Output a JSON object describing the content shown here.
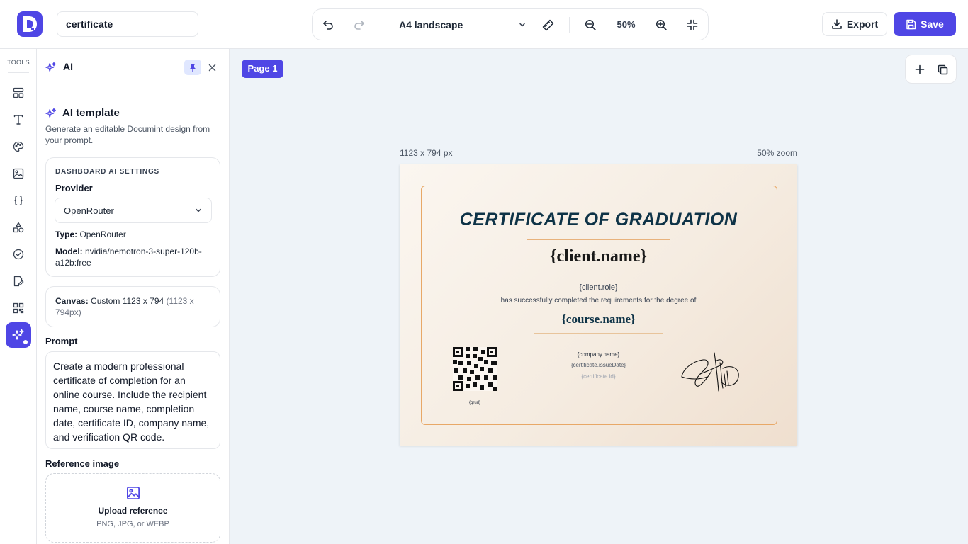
{
  "header": {
    "doc_name": "certificate",
    "page_size": "A4 landscape",
    "zoom": "50%",
    "export_label": "Export",
    "save_label": "Save"
  },
  "rail": {
    "title": "TOOLS",
    "items": [
      "layout-icon",
      "text-icon",
      "palette-icon",
      "image-icon",
      "braces-icon",
      "shapes-icon",
      "check-circle-icon",
      "edit-doc-icon",
      "qr-code-icon",
      "ai-sparkles-icon"
    ]
  },
  "panel": {
    "title": "AI",
    "section_title": "AI template",
    "section_desc": "Generate an editable Documint design from your prompt.",
    "settings": {
      "kicker": "DASHBOARD AI SETTINGS",
      "provider_label": "Provider",
      "provider_value": "OpenRouter",
      "type_key": "Type:",
      "type_value": "OpenRouter",
      "model_key": "Model:",
      "model_value": "nvidia/nemotron-3-super-120b-a12b:free"
    },
    "canvas": {
      "key": "Canvas:",
      "value": "Custom 1123 x 794",
      "note": "(1123 x 794px)"
    },
    "prompt_label": "Prompt",
    "prompt_value": "Create a modern professional certificate of completion for an online course. Include the recipient name, course name, completion date, certificate ID, company name, and verification QR code.",
    "reference_label": "Reference image",
    "upload_title": "Upload reference",
    "upload_sub": "PNG, JPG, or WEBP"
  },
  "canvas_area": {
    "page_tab": "Page 1",
    "dimensions": "1123 x 794 px",
    "zoom_note": "50% zoom"
  },
  "certificate": {
    "title": "CERTIFICATE OF GRADUATION",
    "name": "{client.name}",
    "role": "{client.role}",
    "line": "has successfully completed the requirements for the degree of",
    "course": "{course.name}",
    "qr_label": "{qrurl}",
    "company": "{company.name}",
    "issue_date": "{certificate.issueDate}",
    "cert_id": "{certificate.id}"
  },
  "colors": {
    "accent": "#4f46e5",
    "cert_title": "#0e3347",
    "cert_border": "#e8a867"
  }
}
